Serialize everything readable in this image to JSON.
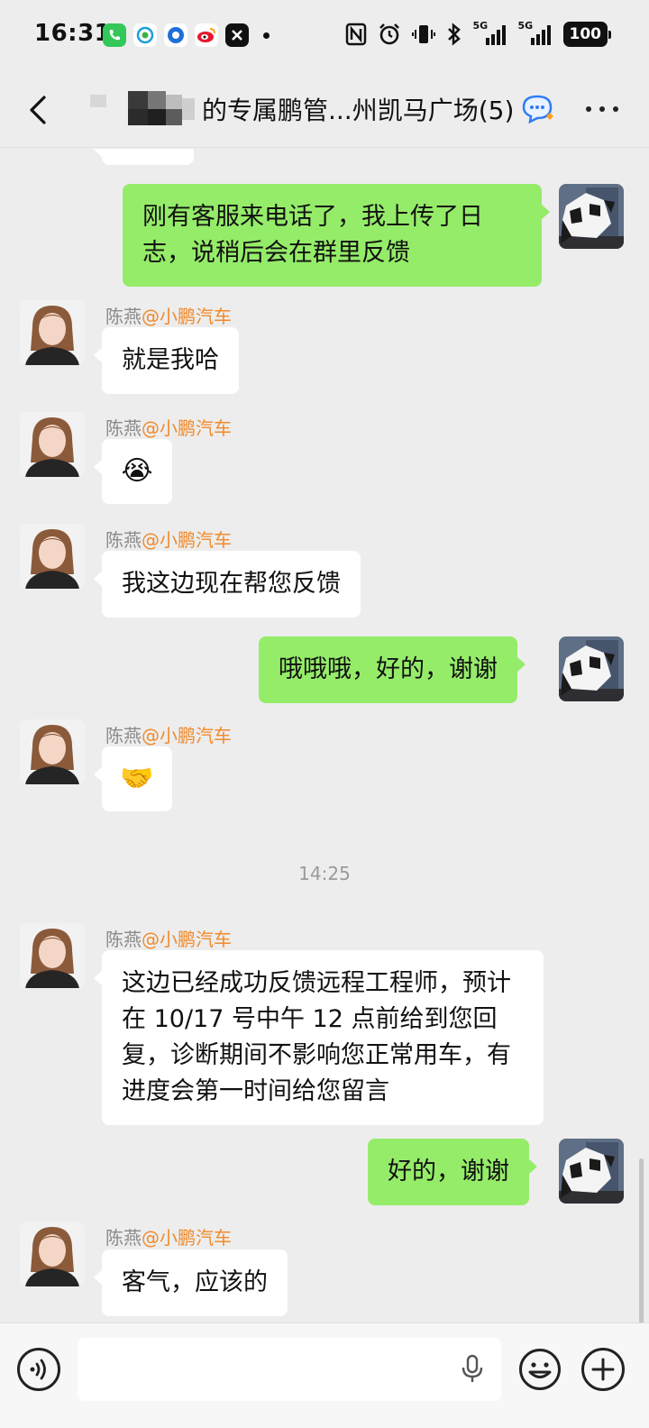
{
  "status_bar": {
    "time": "16:31",
    "battery": "100",
    "signal_1": "5G",
    "signal_2": "5G"
  },
  "header": {
    "title": "的专属鹏管...州凯马广场(5)",
    "back_icon": "chevron-left-icon",
    "more_icon": "more-dots-icon"
  },
  "contact": {
    "name": "陈燕",
    "org": "@小鹏汽车"
  },
  "messages": {
    "m1": "刚有客服来电话了，我上传了日志，说稍后会在群里反馈",
    "m2": "就是我哈",
    "m3_emoji": "😭",
    "m4": "我这边现在帮您反馈",
    "m5": "哦哦哦，好的，谢谢",
    "m6_emoji": "🤝",
    "timestamp": "14:25",
    "m7": "这边已经成功反馈远程工程师，预计在 10/17 号中午 12 点前给到您回复，诊断期间不影响您正常用车，有进度会第一时间给您留言",
    "m8": "好的，谢谢",
    "m9": "客气，应该的"
  },
  "input_bar": {
    "value": "",
    "icons": [
      "voice-icon",
      "microphone-icon",
      "emoji-icon",
      "plus-icon"
    ]
  },
  "colors": {
    "background": "#ededed",
    "outgoing_bubble": "#95ec69",
    "incoming_bubble": "#ffffff",
    "org_text": "#f08a2b"
  }
}
